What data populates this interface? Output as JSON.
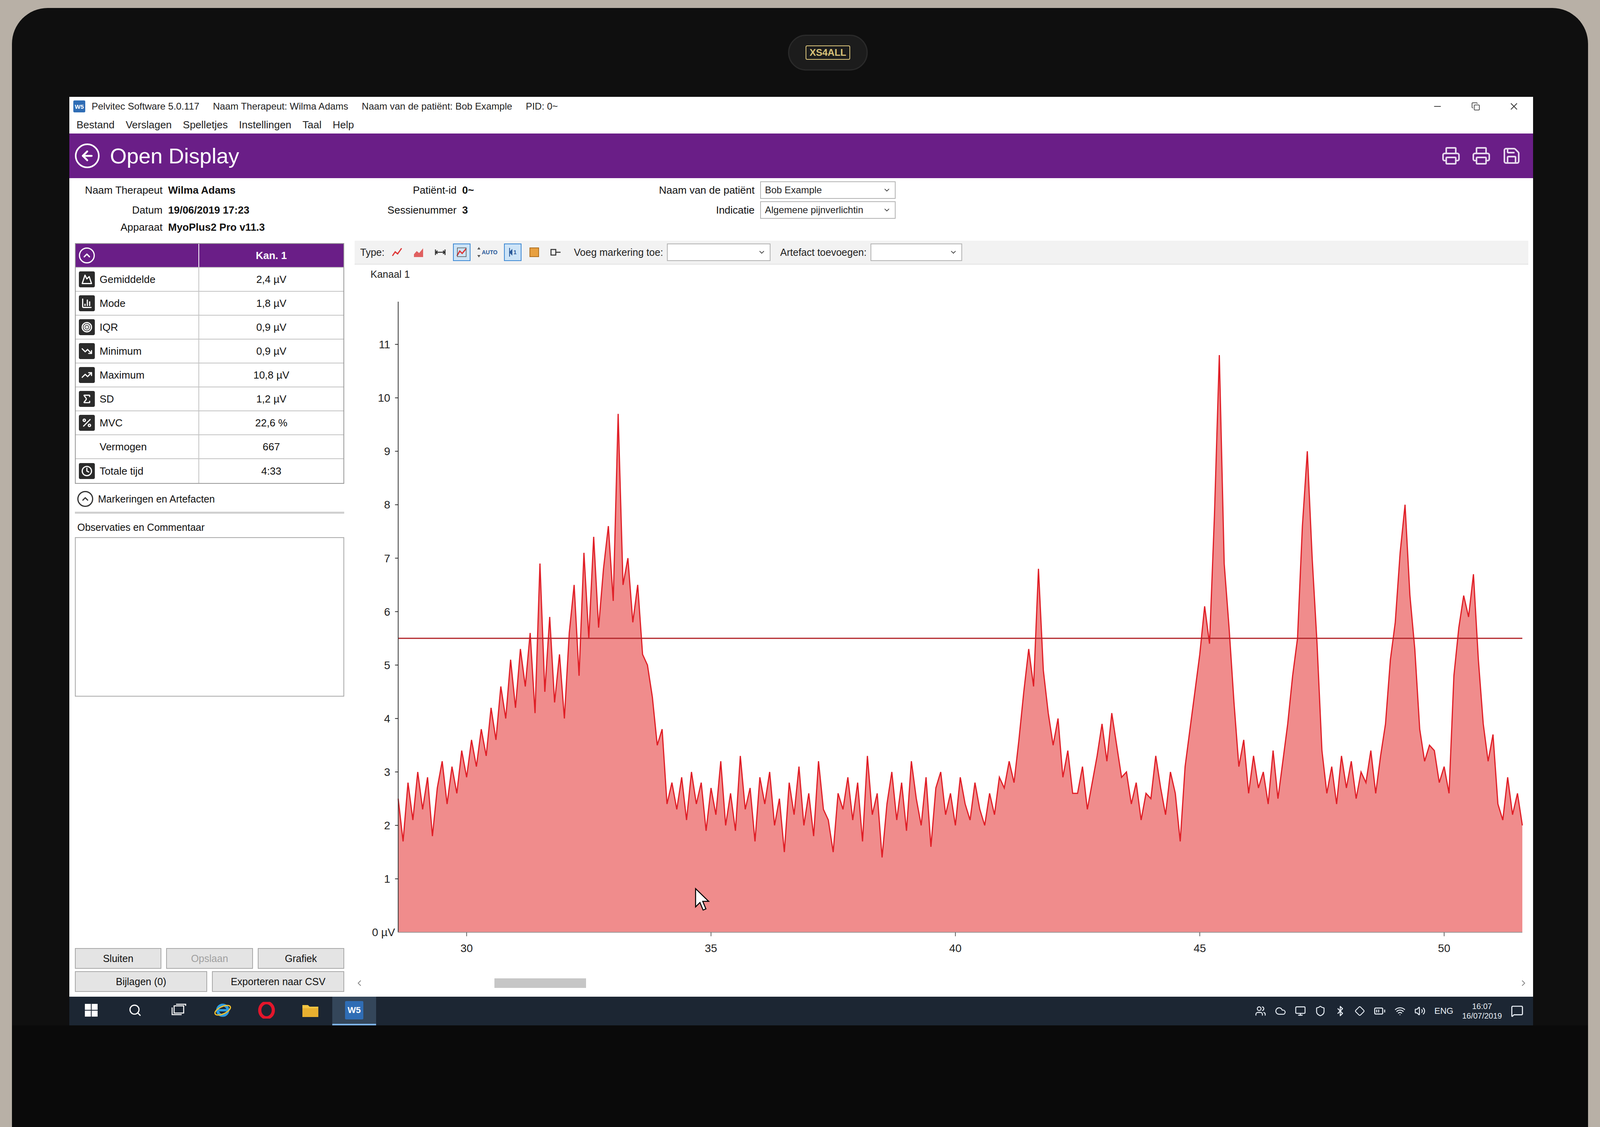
{
  "logo": "W5",
  "camera_cover": "XS4ALL",
  "window": {
    "title_parts": [
      "Pelvitec Software 5.0.117",
      "Naam Therapeut: Wilma Adams",
      "Naam van de patiënt: Bob Example",
      "PID: 0~"
    ]
  },
  "menu": [
    "Bestand",
    "Verslagen",
    "Spelletjes",
    "Instellingen",
    "Taal",
    "Help"
  ],
  "header": {
    "title": "Open Display"
  },
  "info": {
    "therapist": {
      "label": "Naam Therapeut",
      "value": "Wilma Adams"
    },
    "date": {
      "label": "Datum",
      "value": "19/06/2019 17:23"
    },
    "device": {
      "label": "Apparaat",
      "value": "MyoPlus2 Pro v11.3"
    },
    "patient_id": {
      "label": "Patiënt-id",
      "value": "0~"
    },
    "session": {
      "label": "Sessienummer",
      "value": "3"
    },
    "patient": {
      "label": "Naam van de patiënt",
      "value": "Bob Example"
    },
    "indication": {
      "label": "Indicatie",
      "value": "Algemene pijnverlichtin"
    }
  },
  "stats": {
    "header": "Kan. 1",
    "expanded": true,
    "rows": [
      {
        "label": "Gemiddelde",
        "value": "2,4 µV"
      },
      {
        "label": "Mode",
        "value": "1,8 µV"
      },
      {
        "label": "IQR",
        "value": "0,9 µV"
      },
      {
        "label": "Minimum",
        "value": "0,9 µV"
      },
      {
        "label": "Maximum",
        "value": "10,8 µV"
      },
      {
        "label": "SD",
        "value": "1,2 µV"
      },
      {
        "label": "MVC",
        "value": "22,6 %"
      },
      {
        "label": "Vermogen",
        "value": "667"
      },
      {
        "label": "Totale tijd",
        "value": "4:33"
      }
    ]
  },
  "markers": {
    "label": "Markeringen en Artefacten",
    "expanded": true
  },
  "comments": {
    "label": "Observaties en Commentaar",
    "value": ""
  },
  "buttons": [
    {
      "label": "Sluiten",
      "disabled": false
    },
    {
      "label": "Opslaan",
      "disabled": true
    },
    {
      "label": "Grafiek",
      "disabled": false
    },
    {
      "label": "Bijlagen (0)",
      "disabled": false
    },
    {
      "label": "Exporteren naar CSV",
      "disabled": false
    }
  ],
  "toolbar": {
    "type_label": "Type:",
    "tools": [
      {
        "text": "",
        "selected": false
      },
      {
        "text": "",
        "selected": false
      },
      {
        "text": "",
        "selected": false
      },
      {
        "text": "",
        "selected": true
      },
      {
        "text": "AUTO",
        "selected": false
      },
      {
        "text": "1",
        "selected": true
      },
      {
        "text": "",
        "selected": false
      },
      {
        "text": "",
        "selected": false
      }
    ],
    "marker_label": "Voeg markering toe:",
    "marker_value": "",
    "artifact_label": "Artefact toevoegen:",
    "artifact_value": ""
  },
  "chart": {
    "title": "Kanaal 1",
    "y_unit_label": "0 µV",
    "y_ticks": [
      "1",
      "2",
      "3",
      "4",
      "5",
      "6",
      "7",
      "8",
      "9",
      "10",
      "11"
    ],
    "x_ticks": [
      "30",
      "35",
      "40",
      "45",
      "50"
    ],
    "x_start": 28.6,
    "x_step": 0.1,
    "threshold": 5.5,
    "scroll_position": 0.11,
    "series": [
      {
        "name": "Kanaal 1",
        "values": [
          2.5,
          1.7,
          2.8,
          2.1,
          3.0,
          2.3,
          2.9,
          1.8,
          2.7,
          3.2,
          2.4,
          3.1,
          2.6,
          3.4,
          2.9,
          3.6,
          3.1,
          3.8,
          3.3,
          4.2,
          3.6,
          4.6,
          4.0,
          5.1,
          4.2,
          5.3,
          4.6,
          5.6,
          4.1,
          6.9,
          4.5,
          5.9,
          4.3,
          5.2,
          4.0,
          5.6,
          6.5,
          4.8,
          7.1,
          5.5,
          7.4,
          5.7,
          6.8,
          7.6,
          6.2,
          9.7,
          6.5,
          7.0,
          5.8,
          6.5,
          5.2,
          5.0,
          4.4,
          3.5,
          3.8,
          2.4,
          2.8,
          2.3,
          2.9,
          2.1,
          3.0,
          2.4,
          2.8,
          1.9,
          2.7,
          2.2,
          3.2,
          2.0,
          2.6,
          1.9,
          3.3,
          2.3,
          2.7,
          1.7,
          2.9,
          2.4,
          3.0,
          2.0,
          2.5,
          1.5,
          2.8,
          2.2,
          3.1,
          2.0,
          2.6,
          1.8,
          3.2,
          2.3,
          2.1,
          1.5,
          2.6,
          2.3,
          2.9,
          2.1,
          2.8,
          1.7,
          3.3,
          2.2,
          2.6,
          1.4,
          2.4,
          3.0,
          2.1,
          2.8,
          1.9,
          3.2,
          2.5,
          2.0,
          2.9,
          1.6,
          2.7,
          3.0,
          2.2,
          2.6,
          2.0,
          2.9,
          2.4,
          2.1,
          2.8,
          2.3,
          2.0,
          2.6,
          2.2,
          2.9,
          2.7,
          3.2,
          2.8,
          3.6,
          4.5,
          5.3,
          4.6,
          6.8,
          4.9,
          4.1,
          3.5,
          4.0,
          2.9,
          3.4,
          2.6,
          2.6,
          3.1,
          2.3,
          2.8,
          3.3,
          3.9,
          3.2,
          4.1,
          3.5,
          2.9,
          3.0,
          2.4,
          2.8,
          2.1,
          2.6,
          2.5,
          3.3,
          2.7,
          2.2,
          3.0,
          2.6,
          1.7,
          3.1,
          3.8,
          4.5,
          5.2,
          6.1,
          5.4,
          7.8,
          10.8,
          6.9,
          5.7,
          4.3,
          3.1,
          3.6,
          2.6,
          3.3,
          2.7,
          3.0,
          2.4,
          3.4,
          2.5,
          3.2,
          3.9,
          4.8,
          5.5,
          7.6,
          9.0,
          7.0,
          5.4,
          3.4,
          2.6,
          3.1,
          2.4,
          3.3,
          2.7,
          3.2,
          2.5,
          3.0,
          2.8,
          3.4,
          2.6,
          3.3,
          3.9,
          5.1,
          5.8,
          7.1,
          8.0,
          6.3,
          5.3,
          3.8,
          3.2,
          3.5,
          3.4,
          2.8,
          3.1,
          2.6,
          4.8,
          5.7,
          6.3,
          5.9,
          6.7,
          5.1,
          3.9,
          3.2,
          3.7,
          2.4,
          2.1,
          2.9,
          2.2,
          2.6,
          2.0
        ]
      }
    ]
  },
  "taskbar": {
    "language": "ENG",
    "time": "16:07",
    "date": "16/07/2019"
  }
}
